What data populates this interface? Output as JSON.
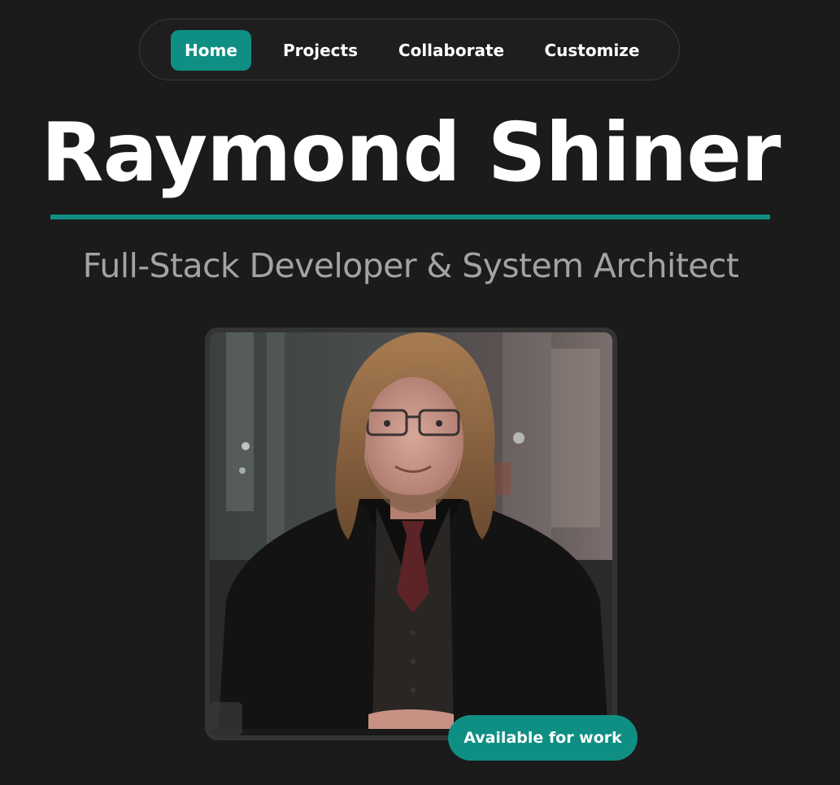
{
  "nav": {
    "items": [
      {
        "label": "Home",
        "active": true
      },
      {
        "label": "Projects",
        "active": false
      },
      {
        "label": "Collaborate",
        "active": false
      },
      {
        "label": "Customize",
        "active": false
      }
    ]
  },
  "hero": {
    "name": "Raymond Shiner",
    "subtitle": "Full-Stack Developer & System Architect"
  },
  "badge": {
    "label": "Available for work"
  },
  "colors": {
    "background": "#1b1b1b",
    "accent": "#0f8f84",
    "subtitle": "#a3a3a3",
    "text": "#ffffff"
  }
}
